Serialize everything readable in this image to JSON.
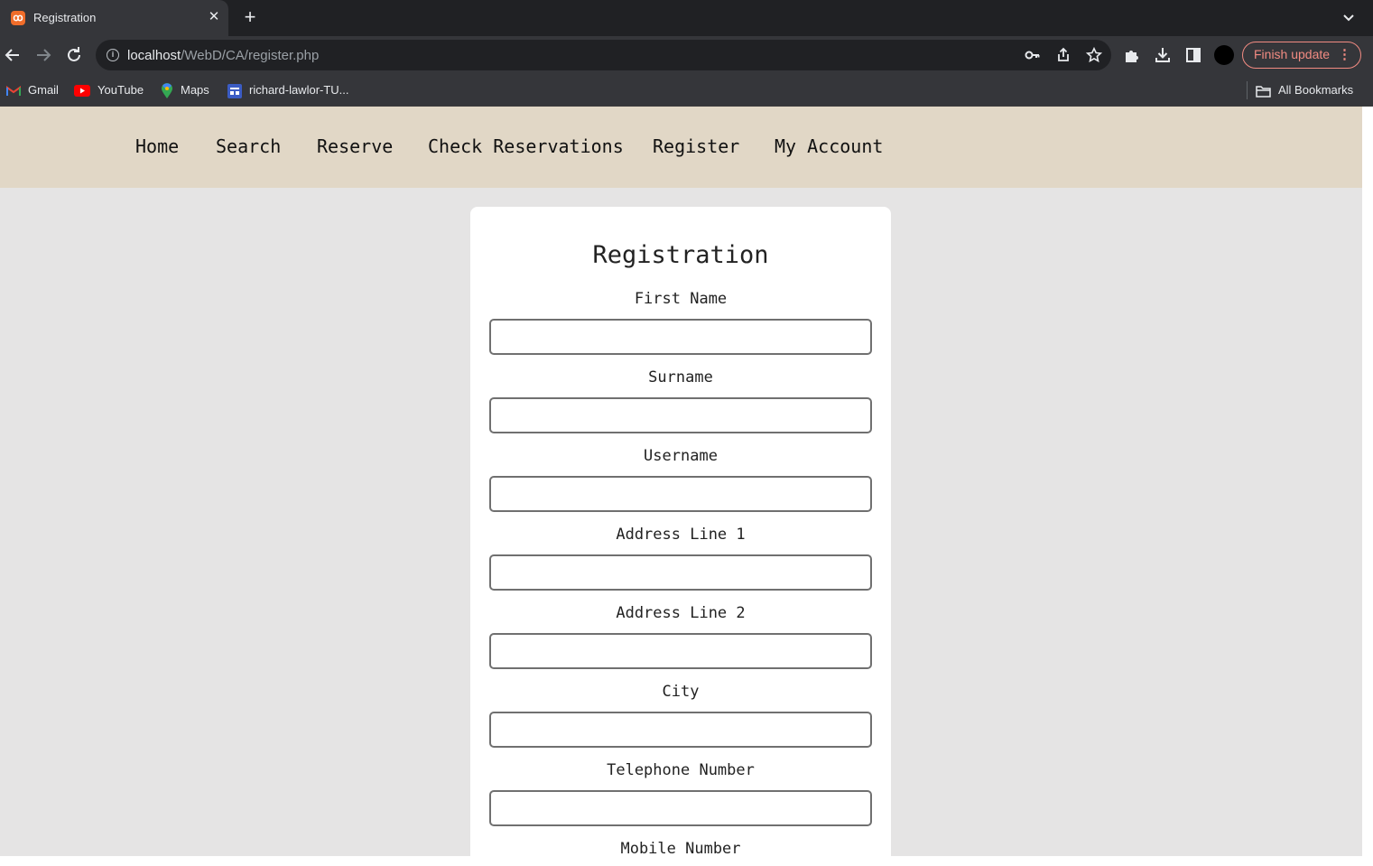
{
  "browser": {
    "tab": {
      "title": "Registration"
    },
    "address": {
      "host": "localhost",
      "path": "/WebD/CA/register.php"
    },
    "finish_update_label": "Finish update",
    "bookmarks": [
      {
        "label": "Gmail",
        "icon": "gmail-icon"
      },
      {
        "label": "YouTube",
        "icon": "youtube-icon"
      },
      {
        "label": "Maps",
        "icon": "maps-icon"
      },
      {
        "label": "richard-lawlor-TU...",
        "icon": "site-icon"
      }
    ],
    "all_bookmarks_label": "All Bookmarks"
  },
  "site_nav": {
    "items": [
      "Home",
      "Search",
      "Reserve",
      "Check Reservations",
      "Register",
      "My Account"
    ]
  },
  "form": {
    "title": "Registration",
    "fields": [
      {
        "label": "First Name",
        "value": ""
      },
      {
        "label": "Surname",
        "value": ""
      },
      {
        "label": "Username",
        "value": ""
      },
      {
        "label": "Address Line 1",
        "value": ""
      },
      {
        "label": "Address Line 2",
        "value": ""
      },
      {
        "label": "City",
        "value": ""
      },
      {
        "label": "Telephone Number",
        "value": ""
      },
      {
        "label": "Mobile Number",
        "value": ""
      }
    ]
  },
  "colors": {
    "nav_bg": "#e1d7c6",
    "page_bg": "#e5e4e4",
    "update_accent": "#f28b82"
  }
}
